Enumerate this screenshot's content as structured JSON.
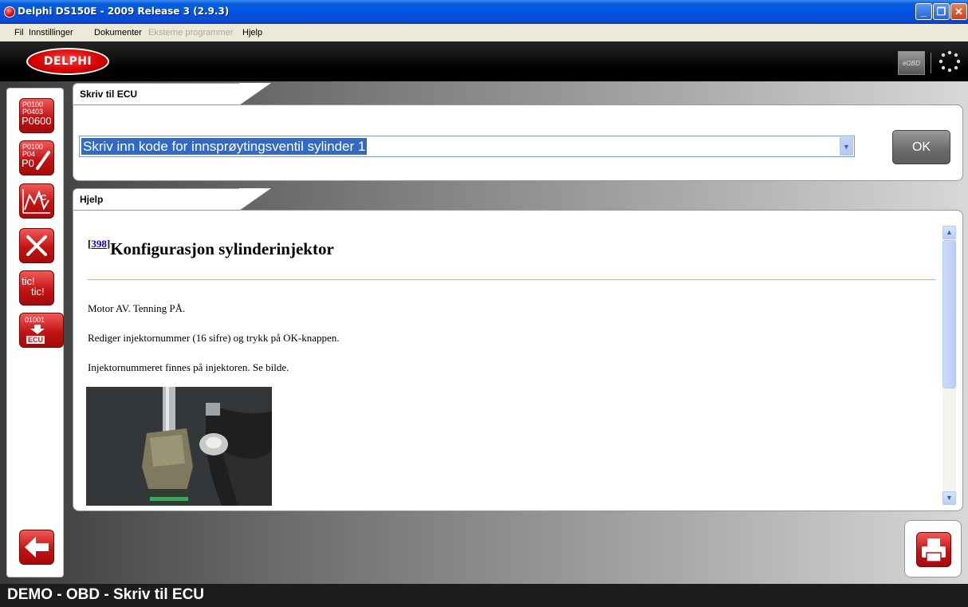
{
  "window": {
    "title": "Delphi DS150E - 2009 Release 3 (2.9.3)",
    "controls": {
      "minimize": "_",
      "maximize": "❐",
      "close": "✕"
    }
  },
  "menu": {
    "items": [
      {
        "label": "Fil",
        "enabled": true
      },
      {
        "label": "Innstillinger",
        "enabled": true
      },
      {
        "label": "Dokumenter",
        "enabled": true
      },
      {
        "label": "Eksterne programmer",
        "enabled": false
      },
      {
        "label": "Hjelp",
        "enabled": true
      }
    ]
  },
  "header": {
    "logo_text": "DELPHI",
    "eobd_label": "eOBD"
  },
  "sidebar": {
    "buttons": [
      {
        "name": "fault-codes",
        "lines": [
          "P0100",
          "P0403",
          "P0600"
        ]
      },
      {
        "name": "erase-fault-codes",
        "lines": [
          "P0100",
          "P04",
          "P0"
        ]
      },
      {
        "name": "live-data",
        "lines": [
          "°C"
        ]
      },
      {
        "name": "component-test",
        "lines": []
      },
      {
        "name": "adjustments",
        "lines": [
          "tic!",
          "tic!"
        ]
      },
      {
        "name": "write-to-ecu",
        "lines": [
          "01001",
          "ECU"
        ]
      }
    ]
  },
  "write_panel": {
    "tab_label": "Skriv til ECU",
    "select_value": "Skriv inn kode for innsprøytingsventil sylinder 1",
    "ok_label": "OK"
  },
  "help_panel": {
    "tab_label": "Hjelp",
    "ref_number": "398",
    "heading": "Konfigurasjon sylinderinjektor",
    "paragraphs": [
      "Motor AV. Tenning PÅ.",
      "Rediger injektornummer (16 sifre) og trykk på OK-knappen.",
      "Injektornummeret finnes på injektoren. Se bilde."
    ]
  },
  "status": {
    "text": "DEMO - OBD - Skriv til ECU"
  },
  "colors": {
    "delphi_red": "#c41313",
    "selection_blue": "#316ac5",
    "xp_titlebar": "#0054e3"
  }
}
